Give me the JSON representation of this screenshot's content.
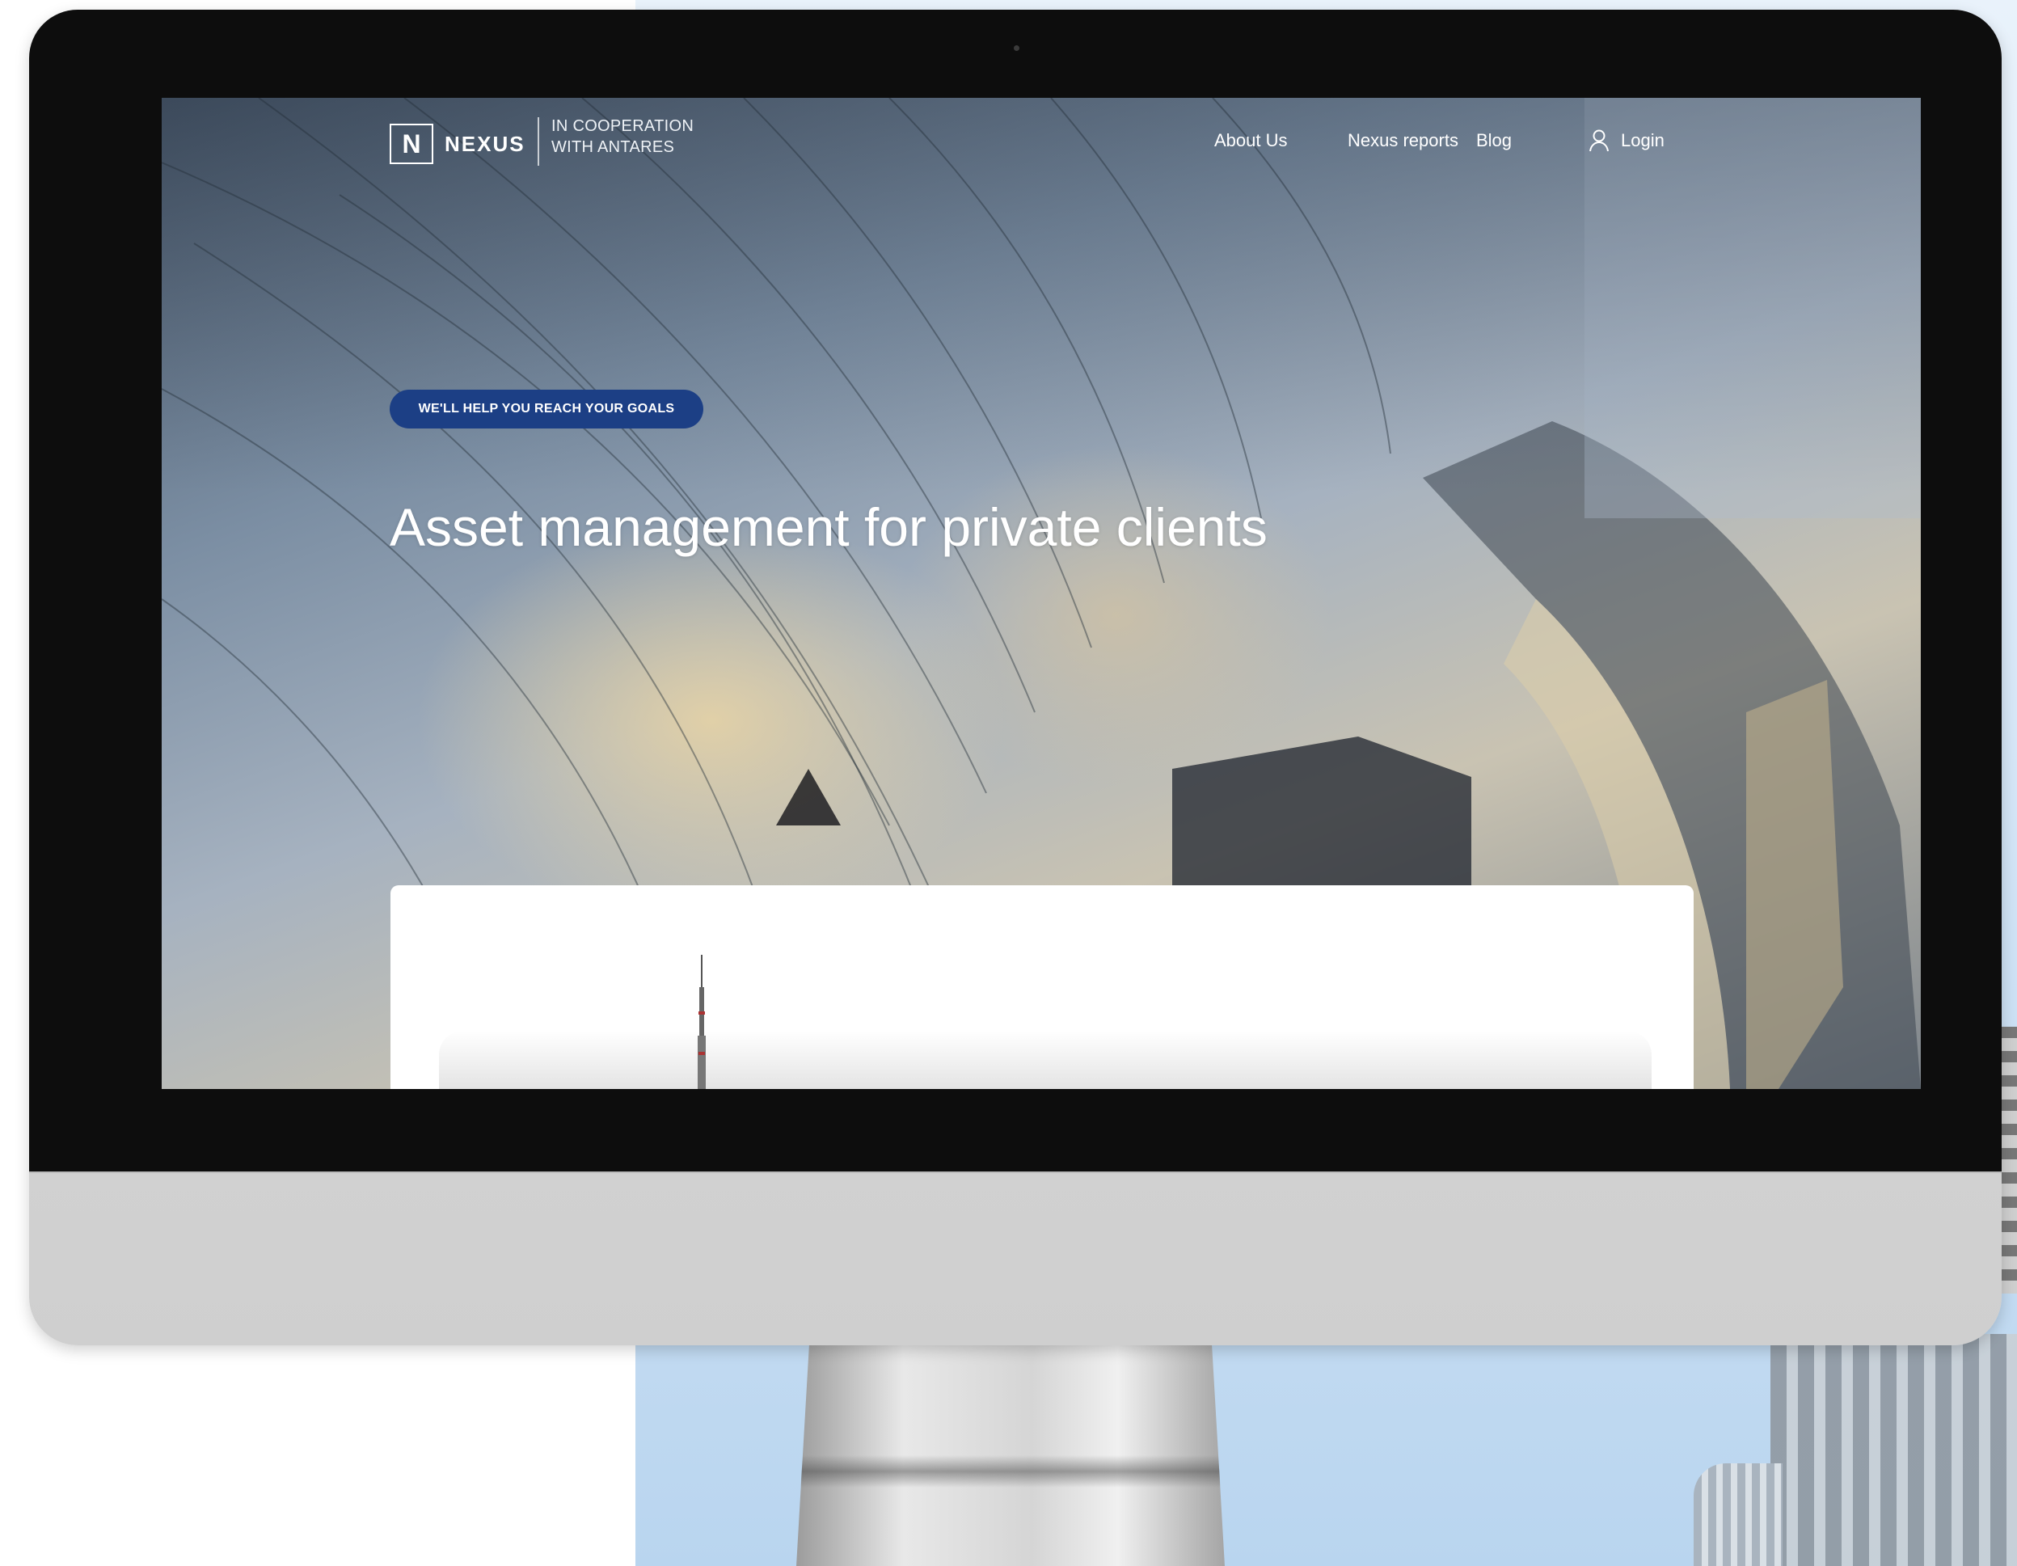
{
  "brand": {
    "logo_letter": "N",
    "name": "NEXUS",
    "cooperation_line1": "IN COOPERATION",
    "cooperation_line2": "WITH ANTARES"
  },
  "nav": {
    "items": [
      {
        "label": "About Us"
      },
      {
        "label": "Nexus reports"
      },
      {
        "label": "Blog"
      }
    ],
    "login_label": "Login",
    "login_icon": "user-icon"
  },
  "hero": {
    "badge": "WE'LL HELP YOU REACH YOUR GOALS",
    "title": "Asset management for private clients"
  },
  "colors": {
    "accent": "#1c3f85",
    "bezel": "#0d0d0d",
    "text_on_image": "#ffffff"
  }
}
